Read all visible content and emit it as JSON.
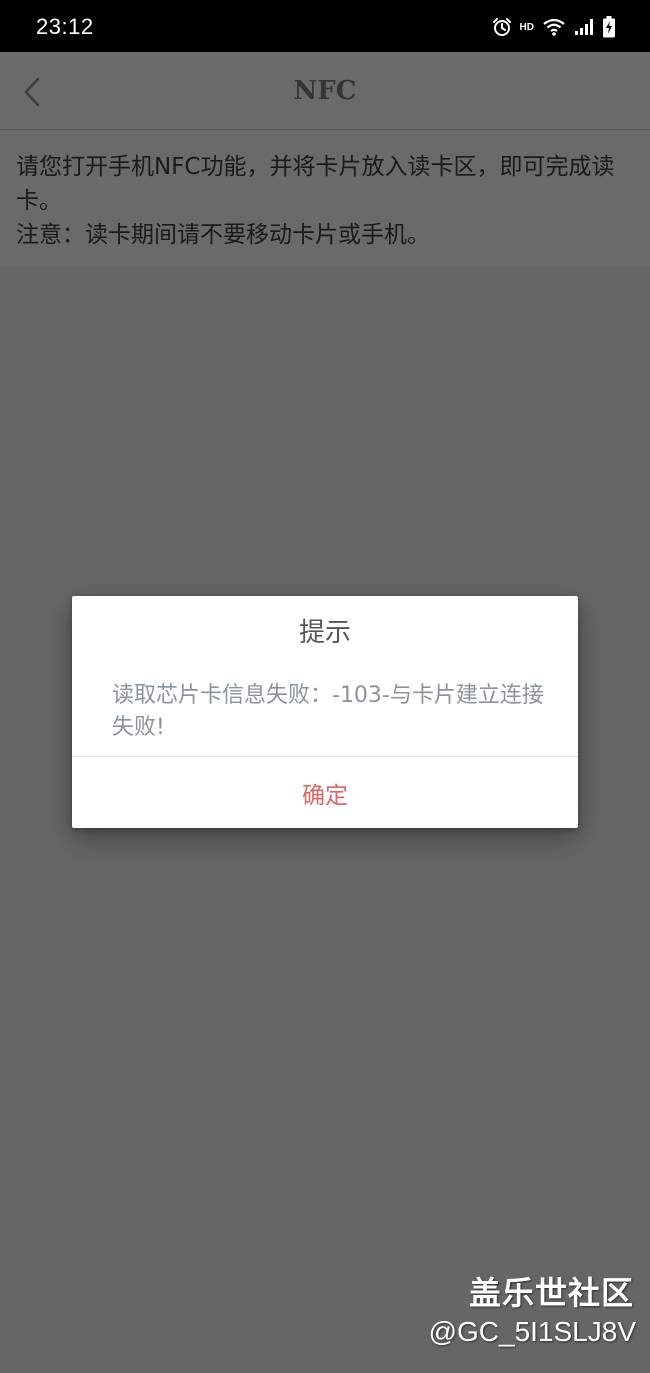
{
  "status_bar": {
    "time": "23:12",
    "icons": [
      "alarm-icon",
      "hd-icon",
      "wifi-icon",
      "signal-icon",
      "battery-charging-icon"
    ],
    "hd_label": "HD"
  },
  "app_bar": {
    "back_icon": "chevron-left-icon",
    "title": "NFC"
  },
  "instructions": {
    "line1": "请您打开手机NFC功能，并将卡片放入读卡区，即可完成读卡。",
    "line2": "注意：读卡期间请不要移动卡片或手机。"
  },
  "dialog": {
    "title": "提示",
    "message": "读取芯片卡信息失败：-103-与卡片建立连接失败!",
    "confirm_label": "确定"
  },
  "watermark": {
    "title": "盖乐世社区",
    "user": "@GC_5I1SLJ8V"
  },
  "colors": {
    "overlay": "#666666",
    "dialog_bg": "#ffffff",
    "confirm_text": "#e16464",
    "message_text": "#8a93a0"
  }
}
